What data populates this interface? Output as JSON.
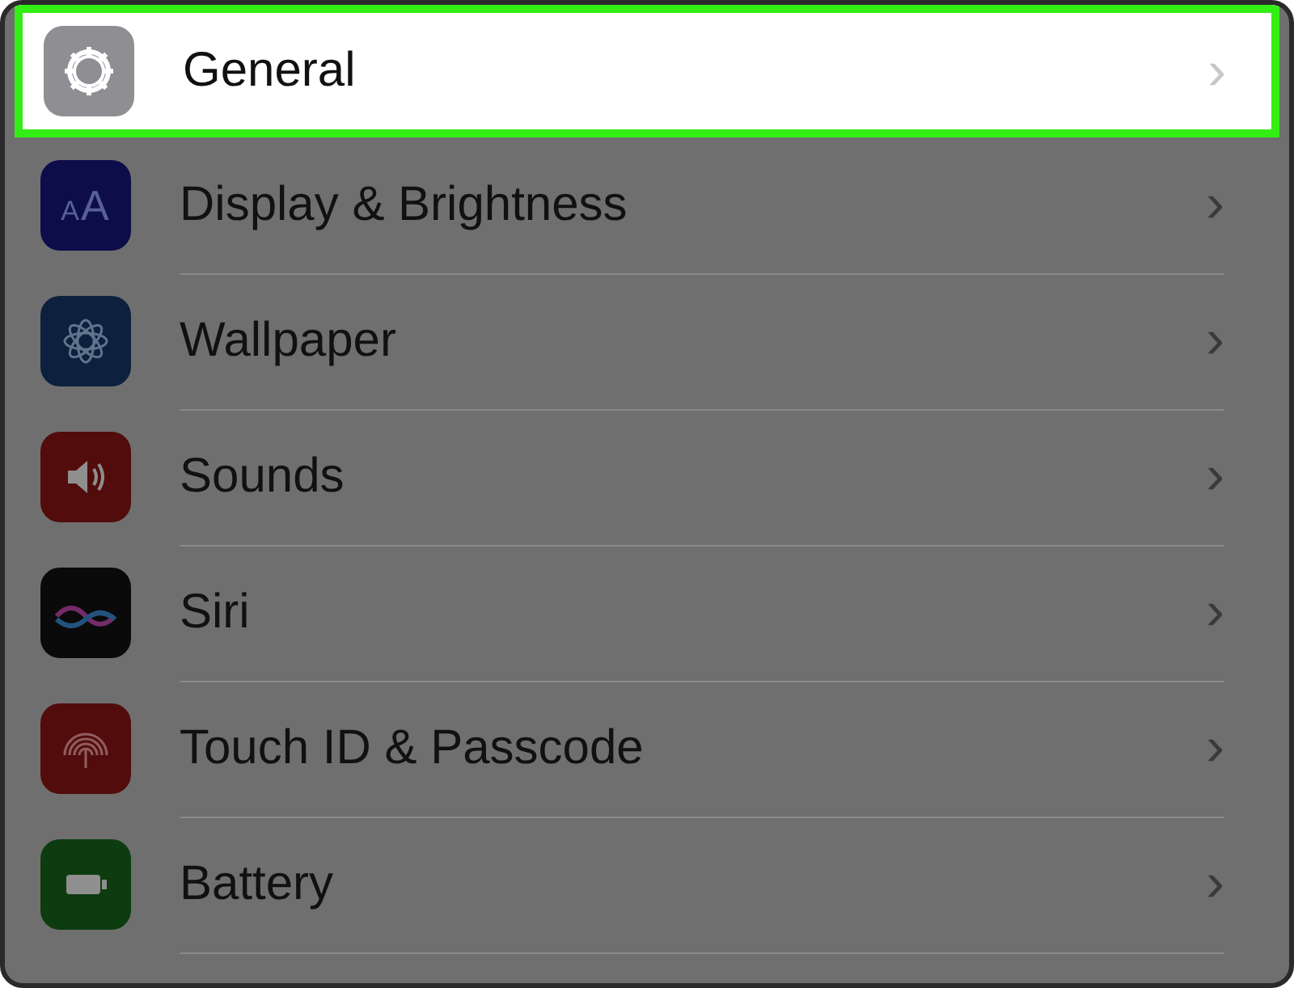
{
  "settings_list": [
    {
      "label": "General",
      "selected": true,
      "chevron": "›"
    },
    {
      "label": "Display & Brightness",
      "icon_text": "AA",
      "selected": false,
      "chevron": "›"
    },
    {
      "label": "Wallpaper",
      "selected": false,
      "chevron": "›"
    },
    {
      "label": "Sounds",
      "selected": false,
      "chevron": "›"
    },
    {
      "label": "Siri",
      "selected": false,
      "chevron": "›"
    },
    {
      "label": "Touch ID & Passcode",
      "selected": false,
      "chevron": "›"
    },
    {
      "label": "Battery",
      "selected": false,
      "chevron": "›"
    }
  ]
}
